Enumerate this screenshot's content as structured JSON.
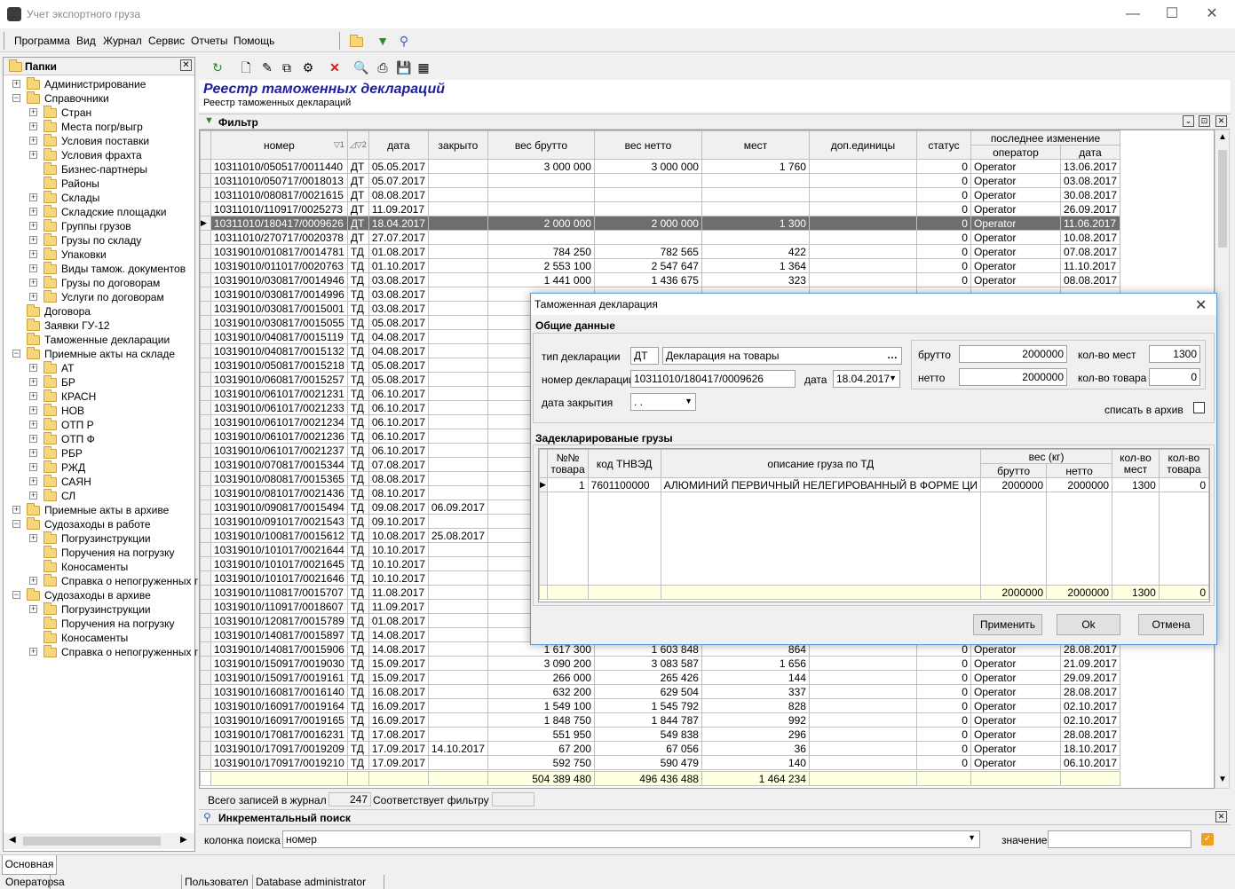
{
  "window": {
    "title": "Учет экспортного груза"
  },
  "menu": [
    "Программа",
    "Вид",
    "Журнал",
    "Сервис",
    "Отчеты",
    "Помощь"
  ],
  "left_panel": {
    "title": "Папки",
    "tree": [
      {
        "label": "Администрирование",
        "level": 0,
        "exp": "+"
      },
      {
        "label": "Справочники",
        "level": 0,
        "exp": "−"
      },
      {
        "label": "Стран",
        "level": 1,
        "exp": "+"
      },
      {
        "label": "Места погр/выгр",
        "level": 1,
        "exp": "+"
      },
      {
        "label": "Условия поставки",
        "level": 1,
        "exp": "+"
      },
      {
        "label": "Условия фрахта",
        "level": 1,
        "exp": "+"
      },
      {
        "label": "Бизнес-партнеры",
        "level": 1,
        "exp": ""
      },
      {
        "label": "Районы",
        "level": 1,
        "exp": ""
      },
      {
        "label": "Склады",
        "level": 1,
        "exp": "+"
      },
      {
        "label": "Складские площадки",
        "level": 1,
        "exp": "+"
      },
      {
        "label": "Группы грузов",
        "level": 1,
        "exp": "+"
      },
      {
        "label": "Грузы по складу",
        "level": 1,
        "exp": "+"
      },
      {
        "label": "Упаковки",
        "level": 1,
        "exp": "+"
      },
      {
        "label": "Виды тамож. документов",
        "level": 1,
        "exp": "+"
      },
      {
        "label": "Грузы по договорам",
        "level": 1,
        "exp": "+"
      },
      {
        "label": "Услуги по договорам",
        "level": 1,
        "exp": "+"
      },
      {
        "label": "Договора",
        "level": 0,
        "exp": ""
      },
      {
        "label": "Заявки ГУ-12",
        "level": 0,
        "exp": ""
      },
      {
        "label": "Таможенные декларации",
        "level": 0,
        "exp": ""
      },
      {
        "label": "Приемные акты на складе",
        "level": 0,
        "exp": "−"
      },
      {
        "label": "АТ",
        "level": 1,
        "exp": "+"
      },
      {
        "label": "БР",
        "level": 1,
        "exp": "+"
      },
      {
        "label": "КРАСН",
        "level": 1,
        "exp": "+"
      },
      {
        "label": "НОВ",
        "level": 1,
        "exp": "+"
      },
      {
        "label": "ОТП Р",
        "level": 1,
        "exp": "+"
      },
      {
        "label": "ОТП Ф",
        "level": 1,
        "exp": "+"
      },
      {
        "label": "РБР",
        "level": 1,
        "exp": "+"
      },
      {
        "label": "РЖД",
        "level": 1,
        "exp": "+"
      },
      {
        "label": "САЯН",
        "level": 1,
        "exp": "+"
      },
      {
        "label": "СЛ",
        "level": 1,
        "exp": "+"
      },
      {
        "label": "Приемные акты в архиве",
        "level": 0,
        "exp": "+"
      },
      {
        "label": "Судозаходы в работе",
        "level": 0,
        "exp": "−"
      },
      {
        "label": "Погрузинструкции",
        "level": 1,
        "exp": "+"
      },
      {
        "label": "Поручения на погрузку",
        "level": 1,
        "exp": ""
      },
      {
        "label": "Коносаменты",
        "level": 1,
        "exp": ""
      },
      {
        "label": "Справка о непогруженных гр",
        "level": 1,
        "exp": "+"
      },
      {
        "label": "Судозаходы в архиве",
        "level": 0,
        "exp": "−"
      },
      {
        "label": "Погрузинструкции",
        "level": 1,
        "exp": "+"
      },
      {
        "label": "Поручения на погрузку",
        "level": 1,
        "exp": ""
      },
      {
        "label": "Коносаменты",
        "level": 1,
        "exp": ""
      },
      {
        "label": "Справка о непогруженных гр",
        "level": 1,
        "exp": "+"
      }
    ]
  },
  "journal": {
    "title": "Реестр таможенных деклараций",
    "subtitle": "Реестр таможенных деклараций",
    "filter_label": "Фильтр",
    "columns": [
      "номер",
      "дата",
      "закрыто",
      "вес брутто",
      "вес нетто",
      "мест",
      "доп.единицы",
      "статус"
    ],
    "sort_marks": [
      "▽1",
      "◿▽2"
    ],
    "last_change_header": "последнее изменение",
    "last_change_sub": [
      "оператор",
      "дата"
    ],
    "rows": [
      [
        "10311010/050517/0011440",
        "ДТ",
        "05.05.2017",
        "",
        "3 000 000",
        "3 000 000",
        "1 760",
        "",
        "0",
        "Operator",
        "13.06.2017"
      ],
      [
        "10311010/050717/0018013",
        "ДТ",
        "05.07.2017",
        "",
        "",
        "",
        "",
        "",
        "0",
        "Operator",
        "03.08.2017"
      ],
      [
        "10311010/080817/0021615",
        "ДТ",
        "08.08.2017",
        "",
        "",
        "",
        "",
        "",
        "0",
        "Operator",
        "30.08.2017"
      ],
      [
        "10311010/110917/0025273",
        "ДТ",
        "11.09.2017",
        "",
        "",
        "",
        "",
        "",
        "0",
        "Operator",
        "26.09.2017"
      ],
      [
        "10311010/180417/0009626",
        "ДТ",
        "18.04.2017",
        "",
        "2 000 000",
        "2 000 000",
        "1 300",
        "",
        "0",
        "Operator",
        "11.06.2017"
      ],
      [
        "10311010/270717/0020378",
        "ДТ",
        "27.07.2017",
        "",
        "",
        "",
        "",
        "",
        "0",
        "Operator",
        "10.08.2017"
      ],
      [
        "10319010/010817/0014781",
        "ТД",
        "01.08.2017",
        "",
        "784 250",
        "782 565",
        "422",
        "",
        "0",
        "Operator",
        "07.08.2017"
      ],
      [
        "10319010/011017/0020763",
        "ТД",
        "01.10.2017",
        "",
        "2 553 100",
        "2 547 647",
        "1 364",
        "",
        "0",
        "Operator",
        "11.10.2017"
      ],
      [
        "10319010/030817/0014946",
        "ТД",
        "03.08.2017",
        "",
        "1 441 000",
        "1 436 675",
        "323",
        "",
        "0",
        "Operator",
        "08.08.2017"
      ],
      [
        "10319010/030817/0014996",
        "ТД",
        "03.08.2017",
        "",
        "",
        "",
        "",
        "",
        "",
        "",
        ""
      ],
      [
        "10319010/030817/0015001",
        "ТД",
        "03.08.2017",
        "",
        "",
        "",
        "",
        "",
        "",
        "",
        ""
      ],
      [
        "10319010/030817/0015055",
        "ТД",
        "05.08.2017",
        "",
        "",
        "",
        "",
        "",
        "",
        "",
        ""
      ],
      [
        "10319010/040817/0015119",
        "ТД",
        "04.08.2017",
        "",
        "",
        "",
        "",
        "",
        "",
        "",
        ""
      ],
      [
        "10319010/040817/0015132",
        "ТД",
        "04.08.2017",
        "",
        "",
        "",
        "",
        "",
        "",
        "",
        ""
      ],
      [
        "10319010/050817/0015218",
        "ТД",
        "05.08.2017",
        "",
        "",
        "",
        "",
        "",
        "",
        "",
        ""
      ],
      [
        "10319010/060817/0015257",
        "ТД",
        "05.08.2017",
        "",
        "",
        "",
        "",
        "",
        "",
        "",
        ""
      ],
      [
        "10319010/061017/0021231",
        "ТД",
        "06.10.2017",
        "",
        "",
        "",
        "",
        "",
        "",
        "",
        ""
      ],
      [
        "10319010/061017/0021233",
        "ТД",
        "06.10.2017",
        "",
        "",
        "",
        "",
        "",
        "",
        "",
        ""
      ],
      [
        "10319010/061017/0021234",
        "ТД",
        "06.10.2017",
        "",
        "",
        "",
        "",
        "",
        "",
        "",
        ""
      ],
      [
        "10319010/061017/0021236",
        "ТД",
        "06.10.2017",
        "",
        "",
        "",
        "",
        "",
        "",
        "",
        ""
      ],
      [
        "10319010/061017/0021237",
        "ТД",
        "06.10.2017",
        "",
        "",
        "",
        "",
        "",
        "",
        "",
        ""
      ],
      [
        "10319010/070817/0015344",
        "ТД",
        "07.08.2017",
        "",
        "",
        "",
        "",
        "",
        "",
        "",
        ""
      ],
      [
        "10319010/080817/0015365",
        "ТД",
        "08.08.2017",
        "",
        "",
        "",
        "",
        "",
        "",
        "",
        ""
      ],
      [
        "10319010/081017/0021436",
        "ТД",
        "08.10.2017",
        "",
        "",
        "",
        "",
        "",
        "",
        "",
        ""
      ],
      [
        "10319010/090817/0015494",
        "ТД",
        "09.08.2017",
        "06.09.2017",
        "",
        "",
        "",
        "",
        "",
        "",
        ""
      ],
      [
        "10319010/091017/0021543",
        "ТД",
        "09.10.2017",
        "",
        "",
        "",
        "",
        "",
        "",
        "",
        ""
      ],
      [
        "10319010/100817/0015612",
        "ТД",
        "10.08.2017",
        "25.08.2017",
        "",
        "",
        "",
        "",
        "",
        "",
        ""
      ],
      [
        "10319010/101017/0021644",
        "ТД",
        "10.10.2017",
        "",
        "",
        "",
        "",
        "",
        "",
        "",
        ""
      ],
      [
        "10319010/101017/0021645",
        "ТД",
        "10.10.2017",
        "",
        "",
        "",
        "",
        "",
        "",
        "",
        ""
      ],
      [
        "10319010/101017/0021646",
        "ТД",
        "10.10.2017",
        "",
        "",
        "",
        "",
        "",
        "",
        "",
        ""
      ],
      [
        "10319010/110817/0015707",
        "ТД",
        "11.08.2017",
        "",
        "",
        "",
        "",
        "",
        "",
        "",
        ""
      ],
      [
        "10319010/110917/0018607",
        "ТД",
        "11.09.2017",
        "",
        "",
        "",
        "",
        "",
        "",
        "",
        ""
      ],
      [
        "10319010/120817/0015789",
        "ТД",
        "01.08.2017",
        "",
        "",
        "",
        "",
        "",
        "",
        "",
        ""
      ],
      [
        "10319010/140817/0015897",
        "ТД",
        "14.08.2017",
        "",
        "",
        "",
        "",
        "",
        "",
        "",
        ""
      ],
      [
        "10319010/140817/0015906",
        "ТД",
        "14.08.2017",
        "",
        "1 617 300",
        "1 603 848",
        "864",
        "",
        "0",
        "Operator",
        "28.08.2017"
      ],
      [
        "10319010/150917/0019030",
        "ТД",
        "15.09.2017",
        "",
        "3 090 200",
        "3 083 587",
        "1 656",
        "",
        "0",
        "Operator",
        "21.09.2017"
      ],
      [
        "10319010/150917/0019161",
        "ТД",
        "15.09.2017",
        "",
        "266 000",
        "265 426",
        "144",
        "",
        "0",
        "Operator",
        "29.09.2017"
      ],
      [
        "10319010/160817/0016140",
        "ТД",
        "16.08.2017",
        "",
        "632 200",
        "629 504",
        "337",
        "",
        "0",
        "Operator",
        "28.08.2017"
      ],
      [
        "10319010/160917/0019164",
        "ТД",
        "16.09.2017",
        "",
        "1 549 100",
        "1 545 792",
        "828",
        "",
        "0",
        "Operator",
        "02.10.2017"
      ],
      [
        "10319010/160917/0019165",
        "ТД",
        "16.09.2017",
        "",
        "1 848 750",
        "1 844 787",
        "992",
        "",
        "0",
        "Operator",
        "02.10.2017"
      ],
      [
        "10319010/170817/0016231",
        "ТД",
        "17.08.2017",
        "",
        "551 950",
        "549 838",
        "296",
        "",
        "0",
        "Operator",
        "28.08.2017"
      ],
      [
        "10319010/170917/0019209",
        "ТД",
        "17.09.2017",
        "14.10.2017",
        "67 200",
        "67 056",
        "36",
        "",
        "0",
        "Operator",
        "18.10.2017"
      ],
      [
        "10319010/170917/0019210",
        "ТД",
        "17.09.2017",
        "",
        "592 750",
        "590 479",
        "140",
        "",
        "0",
        "Operator",
        "06.10.2017"
      ]
    ],
    "selected_row": 4,
    "totals": [
      "504 389 480",
      "496 436 488",
      "1 464 234"
    ]
  },
  "status": {
    "total_label": "Всего записей в журнал",
    "total_value": "247",
    "filter_label": "Соответствует фильтру",
    "filter_value": ""
  },
  "incremental": {
    "title": "Инкрементальный поиск",
    "column_label": "колонка поиска",
    "column_value": "номер",
    "value_label": "значение",
    "value": ""
  },
  "tabs": [
    "Основная"
  ],
  "statusbar": {
    "operator_label": "Оператор",
    "operator_value": "sa",
    "user_label": "Пользовател",
    "user_value": "Database administrator"
  },
  "dialog": {
    "title": "Таможенная декларация",
    "section_general": "Общие данные",
    "type_label": "тип декларации",
    "type_code": "ДТ",
    "type_name": "Декларация на товары",
    "number_label": "номер декларации",
    "number_value": "10311010/180417/0009626",
    "date_label": "дата",
    "date_value": "18.04.2017",
    "close_date_label": "дата закрытия",
    "close_date_value": " .  .",
    "brutto_label": "брутто",
    "brutto_value": "2000000",
    "netto_label": "нетто",
    "netto_value": "2000000",
    "places_label": "кол-во мест",
    "places_value": "1300",
    "goods_qty_label": "кол-во товара",
    "goods_qty_value": "0",
    "archive_label": "списать в архив",
    "section_goods": "Задекларированые грузы",
    "goods_headers": {
      "num": "№№ товара",
      "code": "код ТНВЭД",
      "desc": "описание груза по ТД",
      "weight": "вес (кг)",
      "brutto": "брутто",
      "netto": "нетто",
      "places": "кол-во мест",
      "qty": "кол-во товара"
    },
    "goods_rows": [
      [
        "1",
        "7601100000",
        "АЛЮМИНИЙ ПЕРВИЧНЫЙ НЕЛЕГИРОВАННЫЙ В ФОРМЕ ЦИ",
        "2000000",
        "2000000",
        "1300",
        "0"
      ]
    ],
    "goods_totals": [
      "2000000",
      "2000000",
      "1300",
      "0"
    ],
    "buttons": {
      "apply": "Применить",
      "ok": "Ok",
      "cancel": "Отмена"
    }
  }
}
